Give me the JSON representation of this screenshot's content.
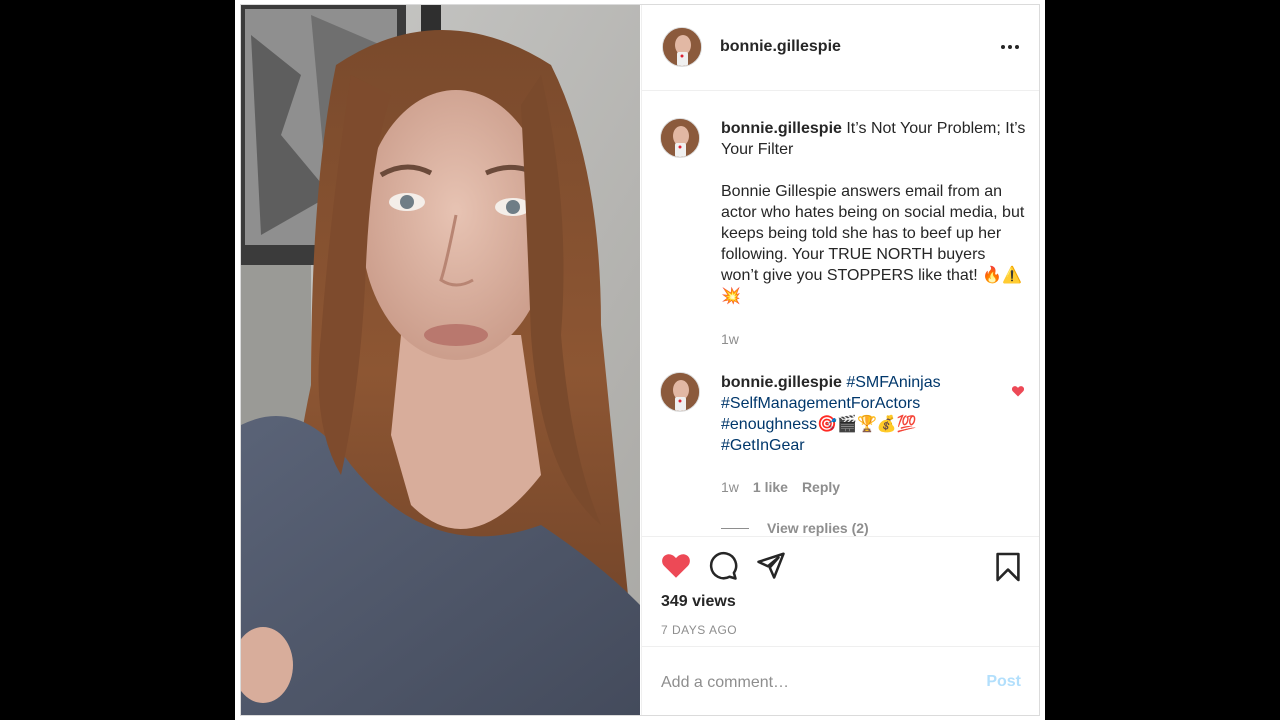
{
  "post": {
    "username": "bonnie.gillespie",
    "more_icon": "more-options-icon"
  },
  "caption": {
    "username": "bonnie.gillespie",
    "title": "It’s Not Your Problem; It’s Your Filter",
    "body": "Bonnie Gillespie answers email from an actor who hates being on social media, but keeps being told she has to beef up her following. Your TRUE NORTH buyers won’t give you STOPPERS like that! 🔥⚠️💥",
    "age": "1w"
  },
  "comment": {
    "username": "bonnie.gillespie",
    "tags": [
      "#SMFAninjas",
      "#SelfManagementForActors",
      "#enoughness",
      "#GetInGear"
    ],
    "emoji": "🎯🎬🏆💰💯",
    "age": "1w",
    "likes": "1 like",
    "reply_label": "Reply",
    "view_replies": "View replies (2)",
    "liked": true
  },
  "actions": {
    "views": "349 views",
    "posted": "7 DAYS AGO",
    "liked": true
  },
  "composer": {
    "placeholder": "Add a comment…",
    "post_label": "Post"
  },
  "colors": {
    "like_red": "#ed4956",
    "link_blue": "#00376b",
    "post_disabled": "#b2dffc"
  }
}
